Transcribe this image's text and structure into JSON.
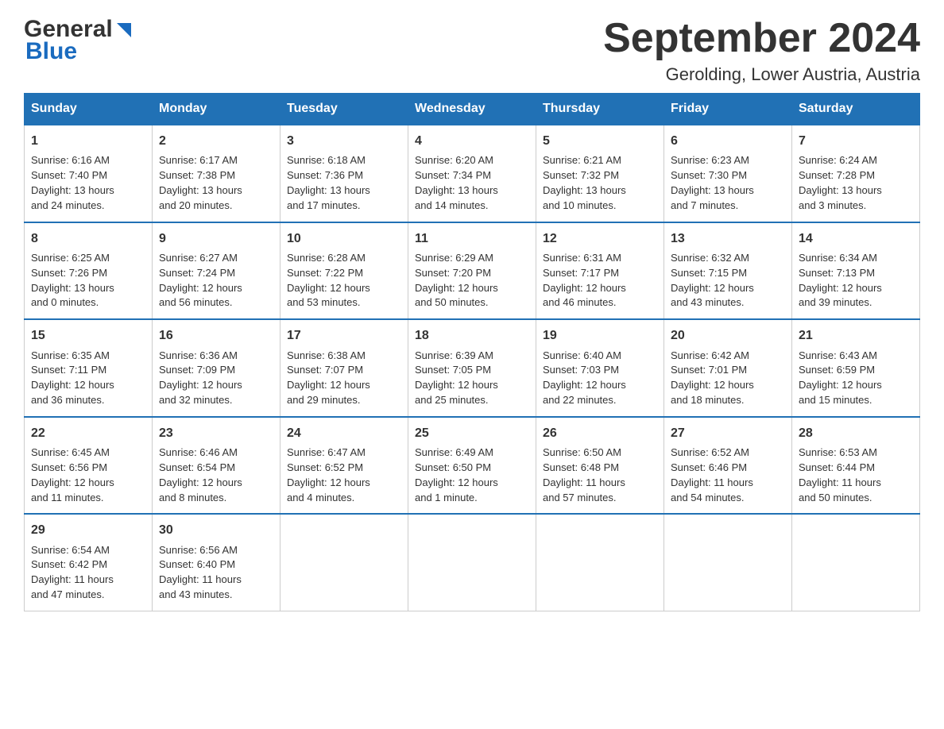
{
  "header": {
    "logo_general": "General",
    "logo_blue": "Blue",
    "month_title": "September 2024",
    "location": "Gerolding, Lower Austria, Austria"
  },
  "days_of_week": [
    "Sunday",
    "Monday",
    "Tuesday",
    "Wednesday",
    "Thursday",
    "Friday",
    "Saturday"
  ],
  "weeks": [
    [
      {
        "day": "1",
        "sunrise": "6:16 AM",
        "sunset": "7:40 PM",
        "daylight": "13 hours and 24 minutes."
      },
      {
        "day": "2",
        "sunrise": "6:17 AM",
        "sunset": "7:38 PM",
        "daylight": "13 hours and 20 minutes."
      },
      {
        "day": "3",
        "sunrise": "6:18 AM",
        "sunset": "7:36 PM",
        "daylight": "13 hours and 17 minutes."
      },
      {
        "day": "4",
        "sunrise": "6:20 AM",
        "sunset": "7:34 PM",
        "daylight": "13 hours and 14 minutes."
      },
      {
        "day": "5",
        "sunrise": "6:21 AM",
        "sunset": "7:32 PM",
        "daylight": "13 hours and 10 minutes."
      },
      {
        "day": "6",
        "sunrise": "6:23 AM",
        "sunset": "7:30 PM",
        "daylight": "13 hours and 7 minutes."
      },
      {
        "day": "7",
        "sunrise": "6:24 AM",
        "sunset": "7:28 PM",
        "daylight": "13 hours and 3 minutes."
      }
    ],
    [
      {
        "day": "8",
        "sunrise": "6:25 AM",
        "sunset": "7:26 PM",
        "daylight": "13 hours and 0 minutes."
      },
      {
        "day": "9",
        "sunrise": "6:27 AM",
        "sunset": "7:24 PM",
        "daylight": "12 hours and 56 minutes."
      },
      {
        "day": "10",
        "sunrise": "6:28 AM",
        "sunset": "7:22 PM",
        "daylight": "12 hours and 53 minutes."
      },
      {
        "day": "11",
        "sunrise": "6:29 AM",
        "sunset": "7:20 PM",
        "daylight": "12 hours and 50 minutes."
      },
      {
        "day": "12",
        "sunrise": "6:31 AM",
        "sunset": "7:17 PM",
        "daylight": "12 hours and 46 minutes."
      },
      {
        "day": "13",
        "sunrise": "6:32 AM",
        "sunset": "7:15 PM",
        "daylight": "12 hours and 43 minutes."
      },
      {
        "day": "14",
        "sunrise": "6:34 AM",
        "sunset": "7:13 PM",
        "daylight": "12 hours and 39 minutes."
      }
    ],
    [
      {
        "day": "15",
        "sunrise": "6:35 AM",
        "sunset": "7:11 PM",
        "daylight": "12 hours and 36 minutes."
      },
      {
        "day": "16",
        "sunrise": "6:36 AM",
        "sunset": "7:09 PM",
        "daylight": "12 hours and 32 minutes."
      },
      {
        "day": "17",
        "sunrise": "6:38 AM",
        "sunset": "7:07 PM",
        "daylight": "12 hours and 29 minutes."
      },
      {
        "day": "18",
        "sunrise": "6:39 AM",
        "sunset": "7:05 PM",
        "daylight": "12 hours and 25 minutes."
      },
      {
        "day": "19",
        "sunrise": "6:40 AM",
        "sunset": "7:03 PM",
        "daylight": "12 hours and 22 minutes."
      },
      {
        "day": "20",
        "sunrise": "6:42 AM",
        "sunset": "7:01 PM",
        "daylight": "12 hours and 18 minutes."
      },
      {
        "day": "21",
        "sunrise": "6:43 AM",
        "sunset": "6:59 PM",
        "daylight": "12 hours and 15 minutes."
      }
    ],
    [
      {
        "day": "22",
        "sunrise": "6:45 AM",
        "sunset": "6:56 PM",
        "daylight": "12 hours and 11 minutes."
      },
      {
        "day": "23",
        "sunrise": "6:46 AM",
        "sunset": "6:54 PM",
        "daylight": "12 hours and 8 minutes."
      },
      {
        "day": "24",
        "sunrise": "6:47 AM",
        "sunset": "6:52 PM",
        "daylight": "12 hours and 4 minutes."
      },
      {
        "day": "25",
        "sunrise": "6:49 AM",
        "sunset": "6:50 PM",
        "daylight": "12 hours and 1 minute."
      },
      {
        "day": "26",
        "sunrise": "6:50 AM",
        "sunset": "6:48 PM",
        "daylight": "11 hours and 57 minutes."
      },
      {
        "day": "27",
        "sunrise": "6:52 AM",
        "sunset": "6:46 PM",
        "daylight": "11 hours and 54 minutes."
      },
      {
        "day": "28",
        "sunrise": "6:53 AM",
        "sunset": "6:44 PM",
        "daylight": "11 hours and 50 minutes."
      }
    ],
    [
      {
        "day": "29",
        "sunrise": "6:54 AM",
        "sunset": "6:42 PM",
        "daylight": "11 hours and 47 minutes."
      },
      {
        "day": "30",
        "sunrise": "6:56 AM",
        "sunset": "6:40 PM",
        "daylight": "11 hours and 43 minutes."
      },
      null,
      null,
      null,
      null,
      null
    ]
  ]
}
